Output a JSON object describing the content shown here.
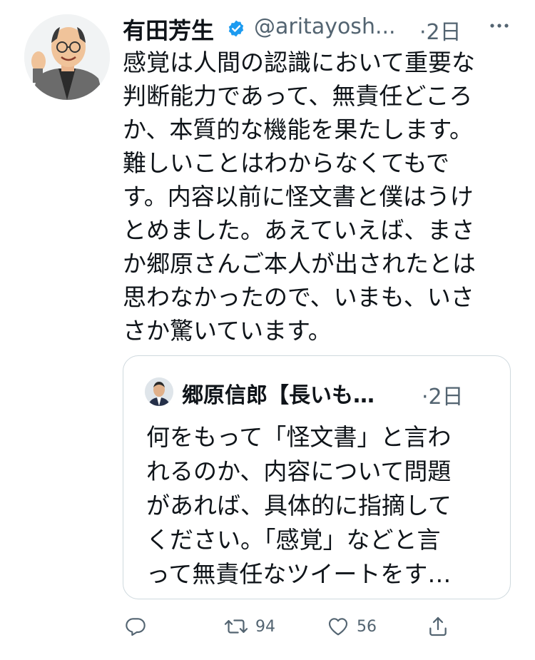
{
  "tweet": {
    "author_name": "有田芳生",
    "handle": "@aritayosh...",
    "time": "·2日",
    "text": "感覚は人間の認識において重要な\n判断能力であって、無責任どころ\nか、本質的な機能を果たします。\n難しいことはわからなくてもで\nす。内容以前に怪文書と僕はうけ\nとめました。あえていえば、まさ\nか郷原さんご本人が出されたとは\n思わなかったので、いまも、いさ\nさか驚いています。"
  },
  "quoted": {
    "author_name": "郷原信郎【長いも…",
    "time": "·2日",
    "text": "何をもって「怪文書」と言わ\nれるのか、内容について問題\nがあれば、具体的に指摘して\nください。「感覚」などと言\nって無責任なツイートをす…"
  },
  "actions": {
    "retweets": "94",
    "likes": "56"
  },
  "icons": {
    "verified": "verified-badge-icon",
    "more": "more-dots-icon",
    "reply": "reply-icon",
    "retweet": "retweet-icon",
    "like": "heart-icon",
    "share": "share-icon"
  },
  "colors": {
    "verified": "#1d9bf0",
    "secondary_text": "#536471",
    "border": "#cfd9de"
  }
}
